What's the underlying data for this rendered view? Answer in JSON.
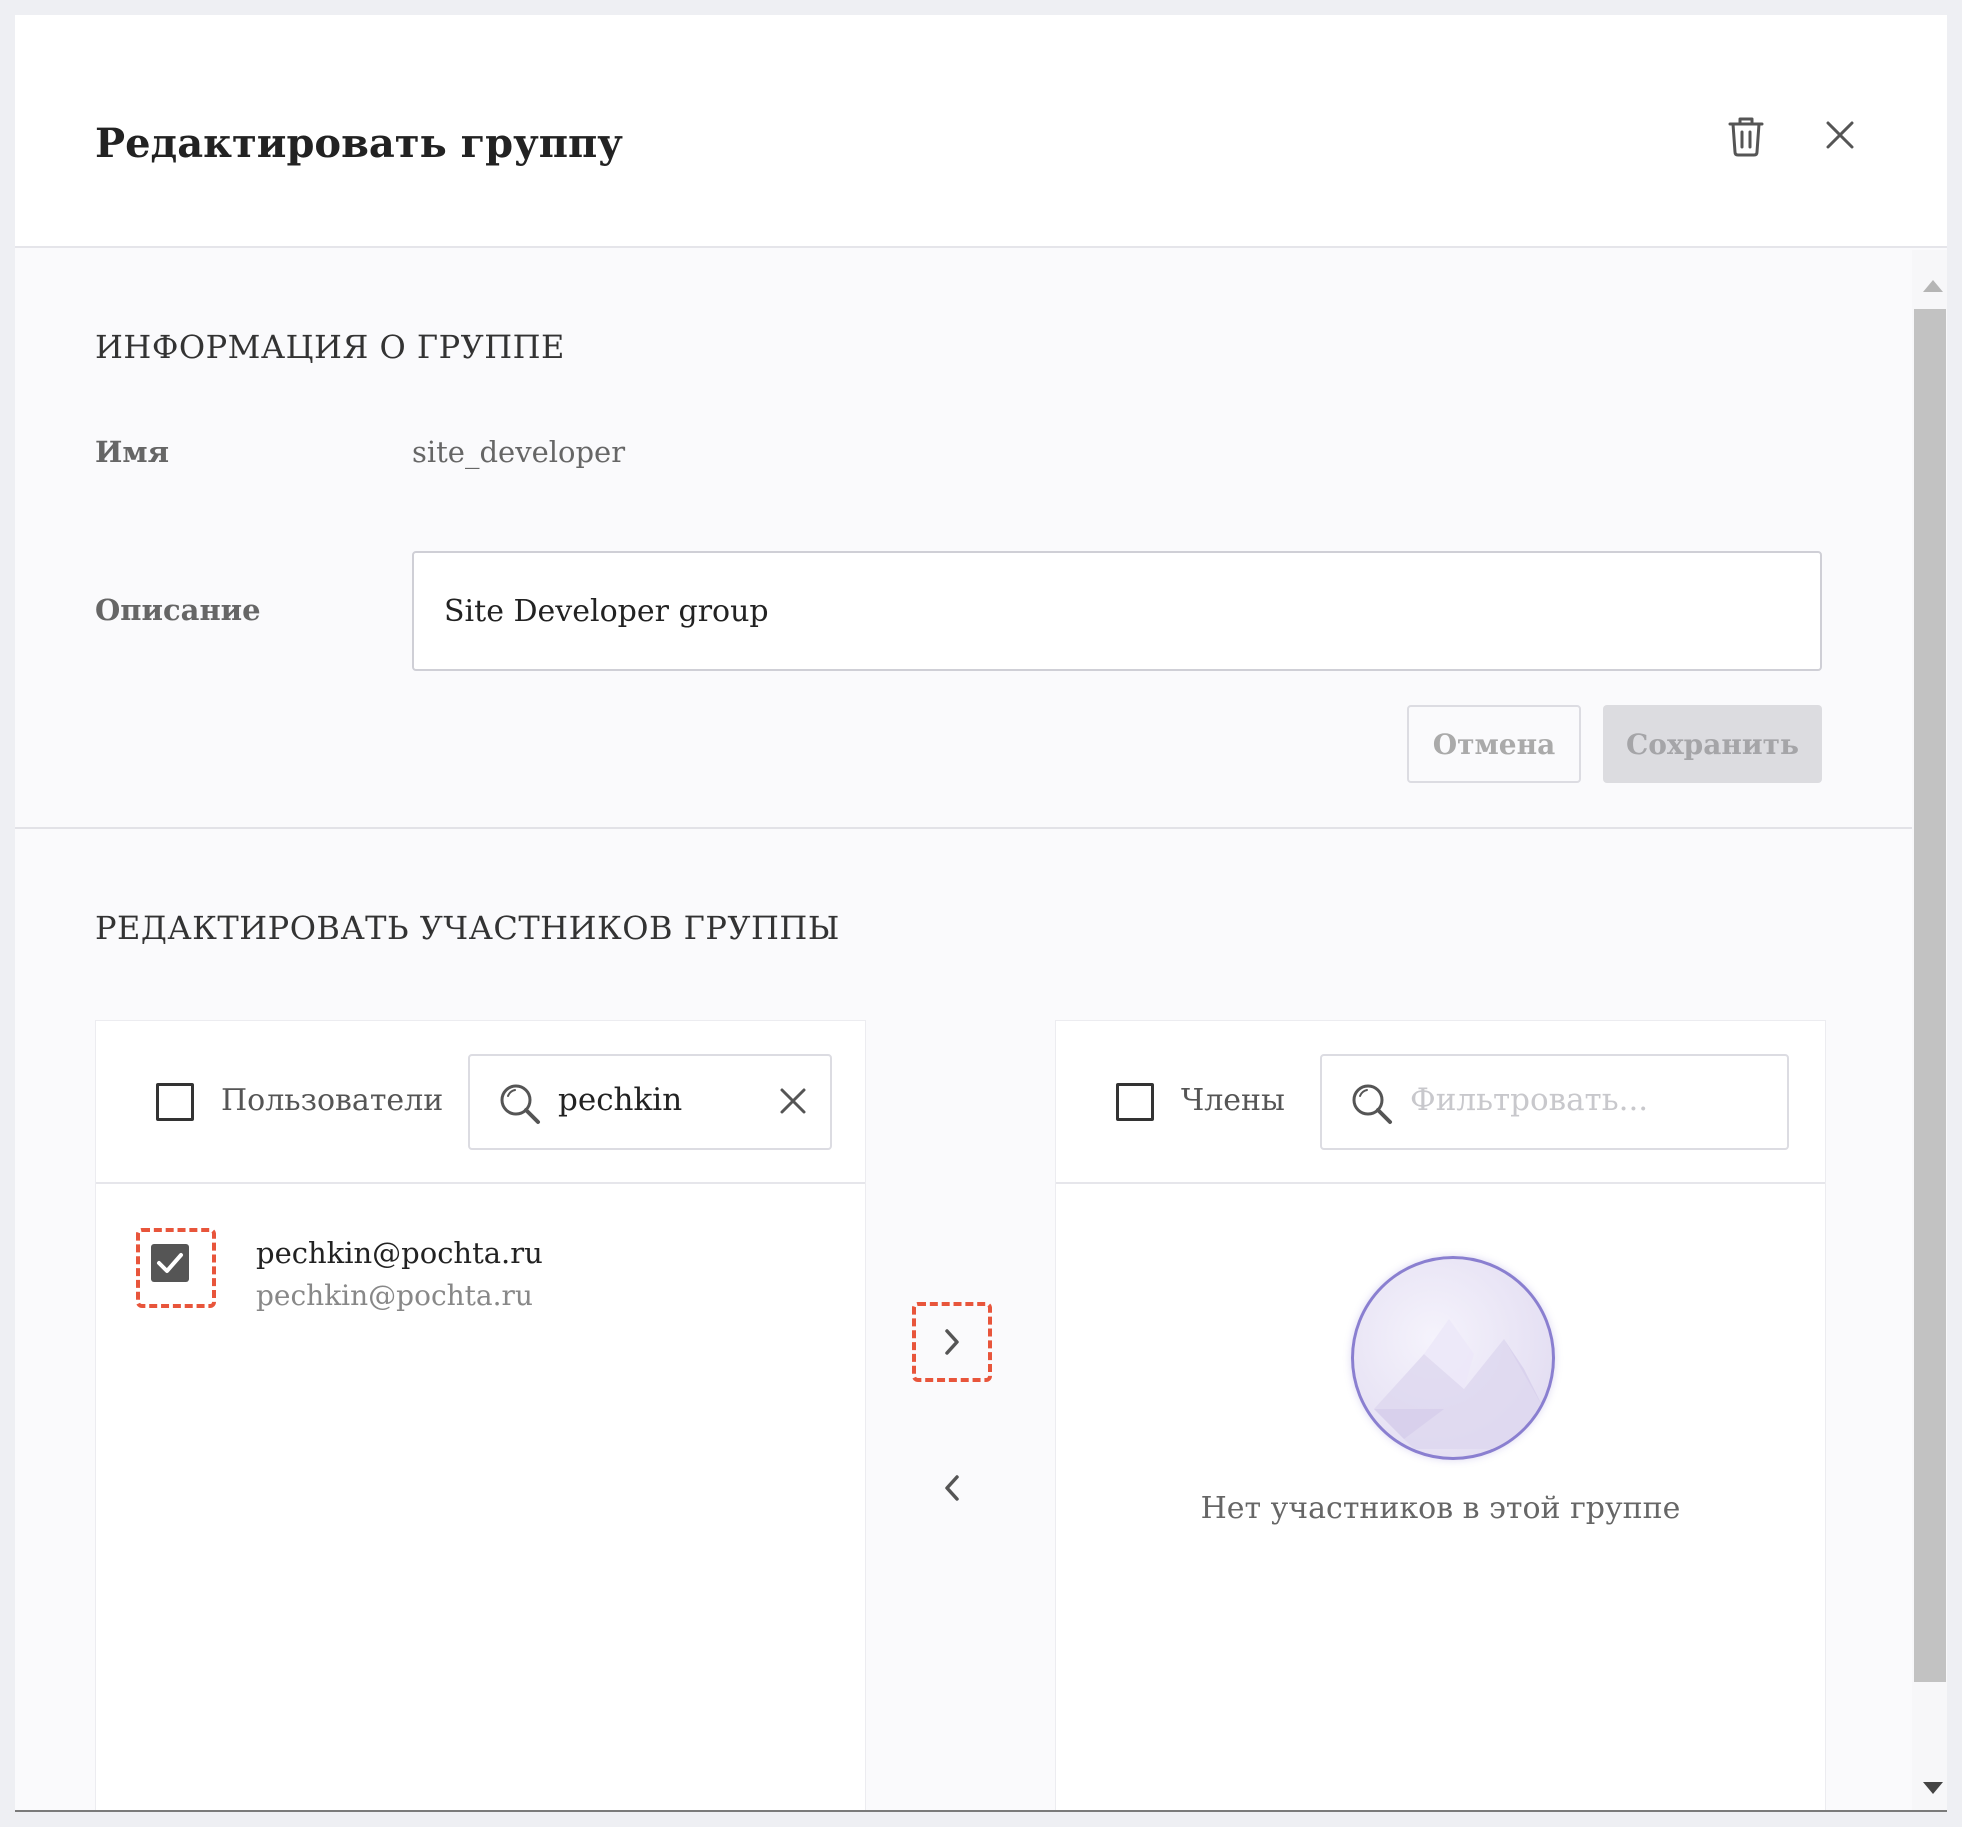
{
  "dialog": {
    "title": "Редактировать группу",
    "icons": {
      "delete": "trash-icon",
      "close": "close-icon"
    }
  },
  "group_info": {
    "section_title": "ИНФОРМАЦИЯ О ГРУППЕ",
    "name_label": "Имя",
    "name_value": "site_developer",
    "description_label": "Описание",
    "description_value": "Site Developer group",
    "cancel_label": "Отмена",
    "save_label": "Сохранить"
  },
  "members": {
    "section_title": "РЕДАКТИРОВАТЬ УЧАСТНИКОВ ГРУППЫ",
    "users_panel": {
      "label": "Пользователи",
      "search_value": "pechkin",
      "items": [
        {
          "name": "pechkin@pochta.ru",
          "email": "pechkin@pochta.ru",
          "checked": true
        }
      ]
    },
    "members_panel": {
      "label": "Члены",
      "search_placeholder": "Фильтровать...",
      "empty_text": "Нет участников в этой группе"
    }
  },
  "colors": {
    "focus_outline": "#e8553b",
    "avatar_border": "#8a7fd0"
  }
}
